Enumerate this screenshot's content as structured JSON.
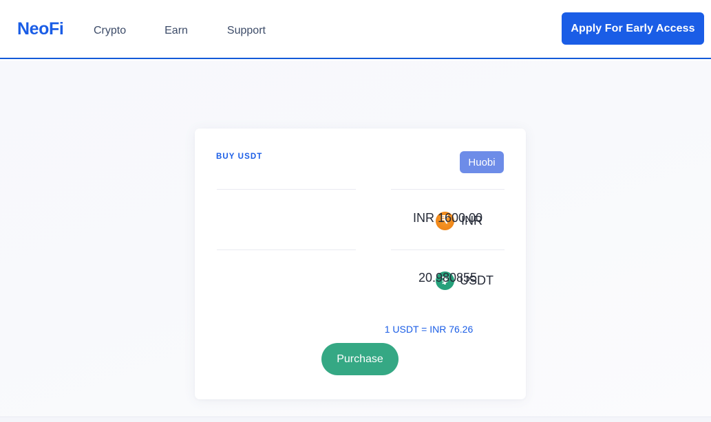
{
  "header": {
    "brand": "NeoFi",
    "nav": [
      {
        "label": "Crypto"
      },
      {
        "label": "Earn"
      },
      {
        "label": "Support"
      }
    ],
    "cta_label": "Apply For Early Access",
    "accent_color": "#1a5de6"
  },
  "card": {
    "title": "BUY USDT",
    "exchange": "Huobi",
    "exchange_badge_color": "#6d8ce8",
    "rows": [
      {
        "icon": "rupee-coin-icon",
        "icon_glyph": "₹",
        "icon_color": "#f0881a",
        "currency": "INR",
        "amount": "INR 1600.00"
      },
      {
        "icon": "tether-coin-icon",
        "icon_glyph": "₮",
        "icon_color": "#26a17b",
        "currency": "USDT",
        "amount": "20.980855"
      }
    ],
    "rate": "1 USDT = INR 76.26",
    "purchase_label": "Purchase",
    "purchase_color": "#35a884"
  }
}
